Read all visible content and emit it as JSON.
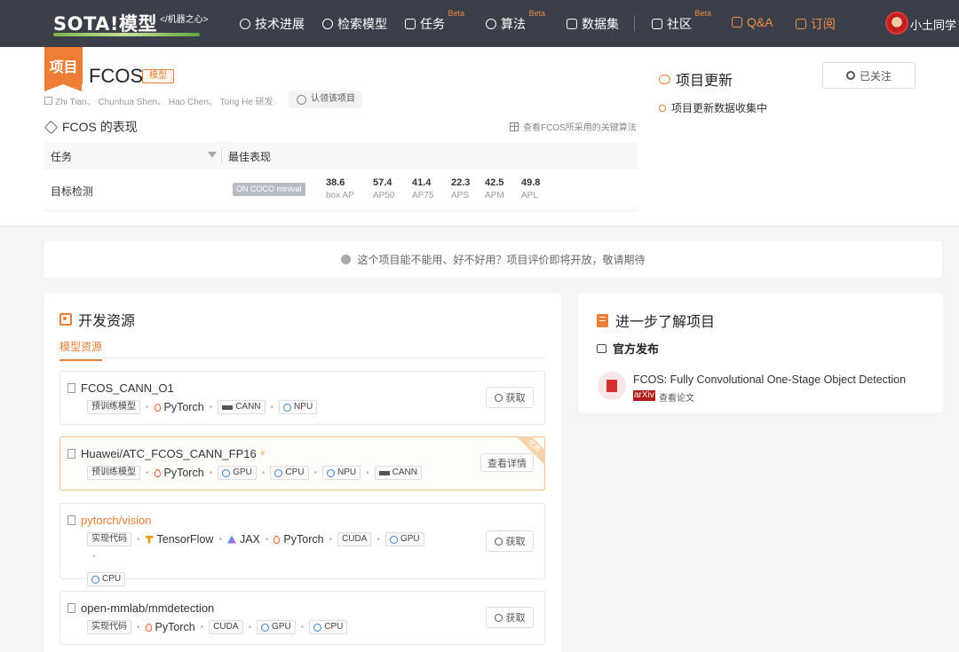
{
  "nav": {
    "logo_text": "SOTA!模型",
    "logo_sub": "</机器之心>",
    "items": [
      {
        "label": "技术进展",
        "icon": "compass-icon"
      },
      {
        "label": "检索模型",
        "icon": "model-icon"
      },
      {
        "label": "任务",
        "icon": "layers-icon",
        "badge": "Beta"
      },
      {
        "label": "算法",
        "icon": "algorithm-icon",
        "badge": "Beta"
      },
      {
        "label": "数据集",
        "icon": "database-icon"
      },
      {
        "label": "社区",
        "icon": "flag-icon",
        "badge": "Beta"
      },
      {
        "label": "Q&A",
        "icon": "question-icon"
      },
      {
        "label": "订阅",
        "icon": "bookmark-icon"
      }
    ],
    "user_name": "小土同学"
  },
  "project": {
    "badge": "项目",
    "title": "FCOS",
    "type_tag": "模型",
    "authors": "Zhi Tian、 Chunhua Shen、 Hao Chen、 Tong He 研发",
    "claim_label": "认领该项目"
  },
  "performance": {
    "title": "FCOS 的表现",
    "algo_link": "查看FCOS所采用的关键算法",
    "col_task": "任务",
    "col_best": "最佳表现",
    "rows": [
      {
        "task": "目标检测",
        "dataset": "ON COCO minival",
        "metrics": [
          {
            "value": "38.6",
            "label": "box AP"
          },
          {
            "value": "57.4",
            "label": "AP50"
          },
          {
            "value": "41.4",
            "label": "AP75"
          },
          {
            "value": "22.3",
            "label": "APS"
          },
          {
            "value": "42.5",
            "label": "APM"
          },
          {
            "value": "49.8",
            "label": "APL"
          }
        ]
      }
    ]
  },
  "updates": {
    "title": "项目更新",
    "follow_label": "已关注",
    "item": "项目更新数据收集中"
  },
  "notice": "这个项目能不能用、好不好用？项目评价即将开放，敬请期待",
  "dev_resources": {
    "title": "开发资源",
    "tab": "模型资源",
    "items": [
      {
        "name": "FCOS_CANN_O1",
        "tag_rows": [
          [
            "预训练模型",
            "PyTorch",
            "CANN",
            "NPU"
          ]
        ],
        "button": "获取"
      },
      {
        "name": "Huawei/ATC_FCOS_CANN_FP16",
        "ribbon": "优质",
        "tag_rows": [
          [
            "预训练模型",
            "PyTorch",
            "GPU",
            "CPU",
            "NPU",
            "CANN"
          ]
        ],
        "button": "查看详情"
      },
      {
        "name": "pytorch/vision",
        "tag_rows": [
          [
            "实现代码",
            "TensorFlow",
            "JAX",
            "PyTorch",
            "CUDA",
            "GPU"
          ],
          [
            "CPU"
          ]
        ],
        "button": "获取"
      },
      {
        "name": "open-mmlab/mmdetection",
        "tag_rows": [
          [
            "实现代码",
            "PyTorch",
            "CUDA",
            "GPU",
            "CPU"
          ]
        ],
        "button": "获取"
      }
    ]
  },
  "learn_more": {
    "title": "进一步了解项目",
    "official_title": "官方发布",
    "paper_title": "FCOS: Fully Convolutional One-Stage Object Detection",
    "paper_source": "arXiv",
    "paper_link": "查看论文"
  }
}
